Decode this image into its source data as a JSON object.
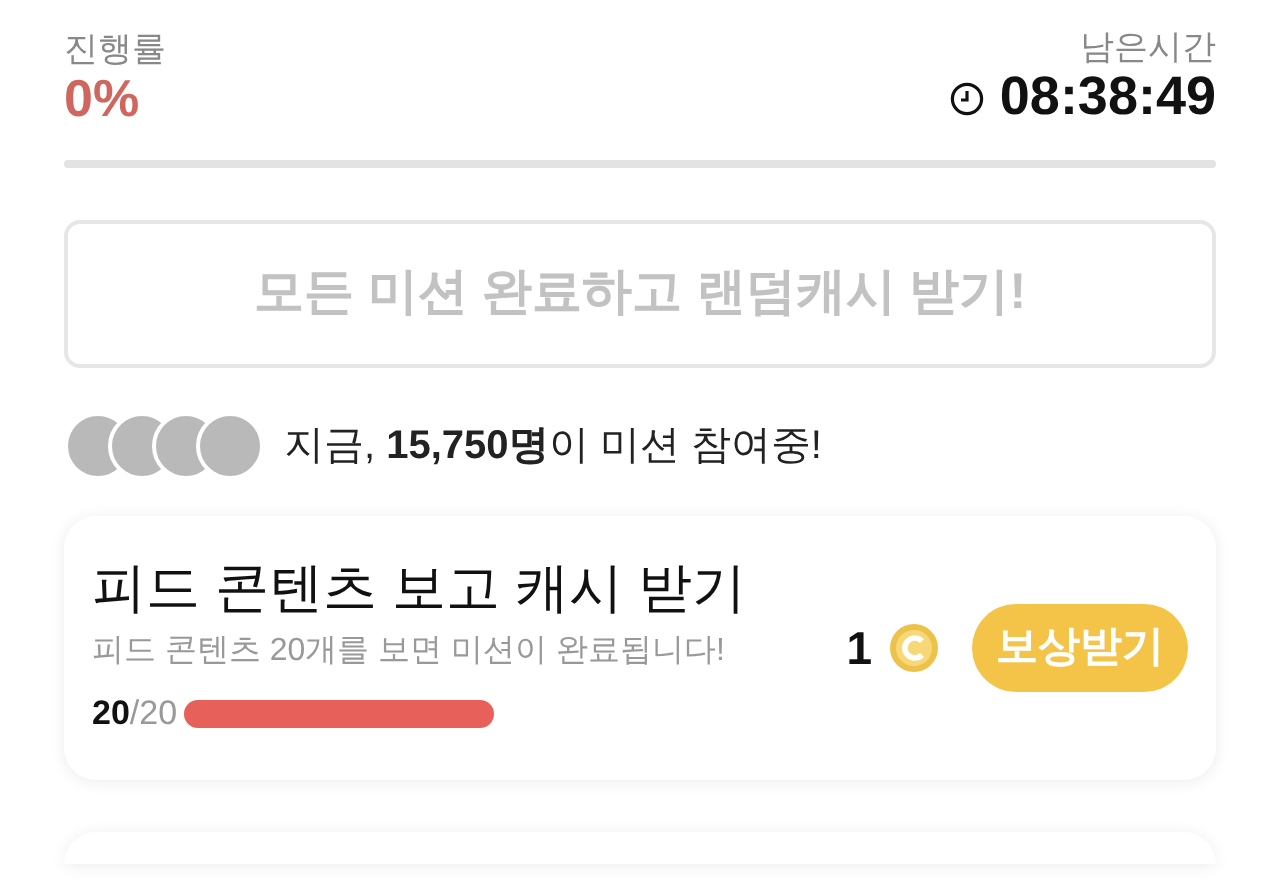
{
  "progress": {
    "label": "진행률",
    "value": "0%",
    "level": 0
  },
  "timer": {
    "label": "남은시간",
    "value": "08:38:49"
  },
  "all_missions_button": {
    "label": "모든 미션 완료하고 랜덤캐시 받기!",
    "disabled": true
  },
  "participants": {
    "text": "지금, **15,750명**이 미션 참여중!"
  },
  "missions": [
    {
      "title": "피드 콘텐츠 보고 캐시 받기",
      "description": "피드 콘텐츠 20개를 보면 미션이 완료됩니다!",
      "count_done": "20",
      "count_total": "/20",
      "level": 1,
      "reward": "1",
      "button": "보상받기"
    }
  ]
}
